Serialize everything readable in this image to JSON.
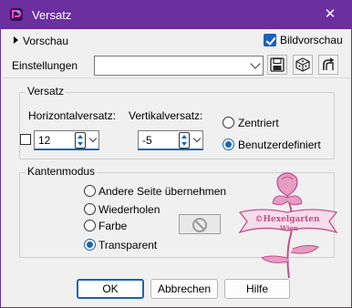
{
  "window": {
    "title": "Versatz",
    "close_glyph": "✕",
    "accent": "#6b2fa0"
  },
  "top": {
    "preview_label": "Vorschau",
    "bildvorschau_label": "Bildvorschau",
    "bildvorschau_checked": true,
    "settings_label": "Einstellungen",
    "settings_value": ""
  },
  "offset": {
    "legend": "Versatz",
    "horizontal_label": "Horizontalversatz:",
    "vertical_label": "Vertikalversatz:",
    "horizontal_value": "12",
    "vertical_value": "-5",
    "radio_centered": "Zentriert",
    "radio_custom": "Benutzerdefiniert",
    "selected": "Benutzerdefiniert"
  },
  "edge_mode": {
    "legend": "Kantenmodus",
    "options": [
      "Andere Seite übernehmen",
      "Wiederholen",
      "Farbe",
      "Transparent"
    ],
    "selected": "Transparent"
  },
  "watermark": {
    "line1": "©Hexelgarten",
    "line2": "Wien"
  },
  "buttons": {
    "ok": "OK",
    "cancel": "Abbrechen",
    "help": "Hilfe"
  },
  "colors": {
    "accent_blue": "#1a63b8",
    "watermark_pink": "#d0609a"
  }
}
